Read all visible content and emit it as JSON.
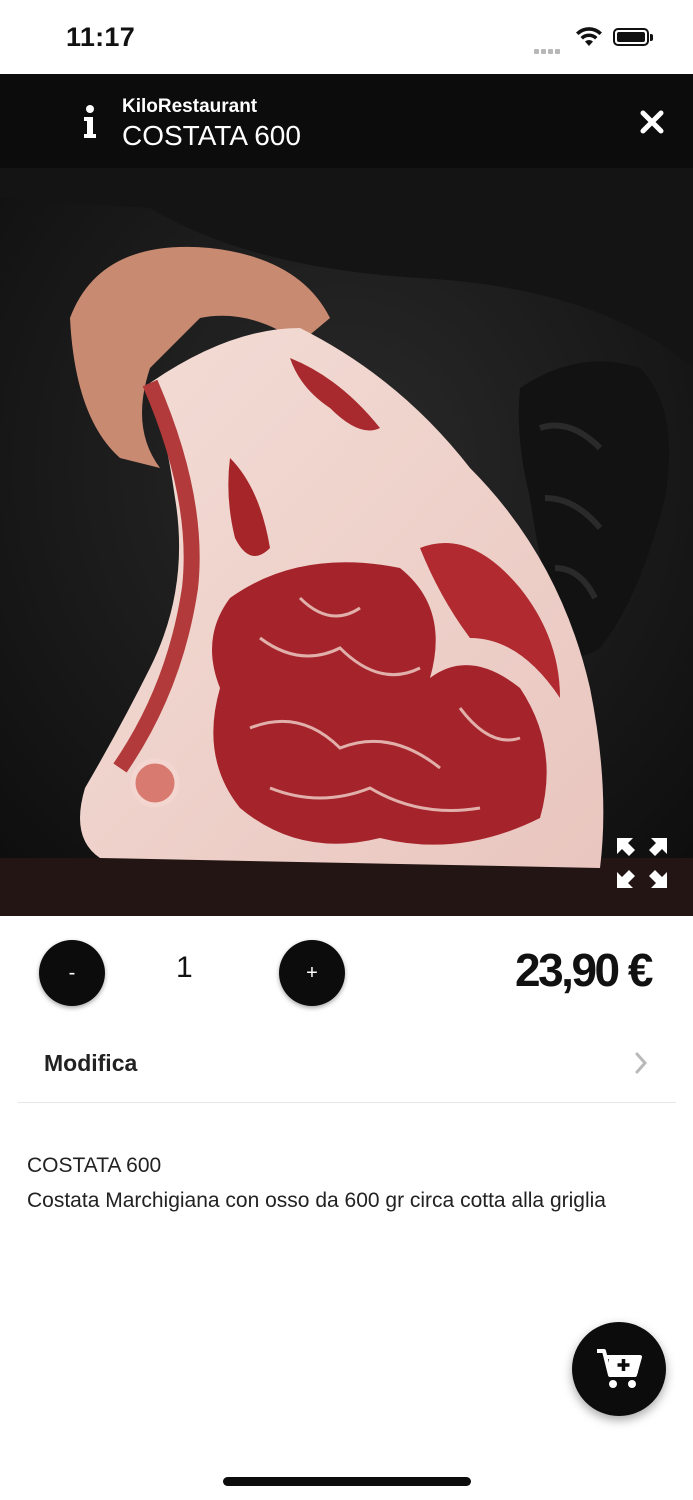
{
  "status_bar": {
    "time": "11:17"
  },
  "header": {
    "subtitle": "KiloRestaurant",
    "title": "COSTATA 600",
    "info_icon": "info-icon",
    "close_icon": "close-icon"
  },
  "hero": {
    "expand_icon": "expand-icon"
  },
  "quantity": {
    "minus_label": "-",
    "value": "1",
    "plus_label": "+"
  },
  "price": "23,90 €",
  "modifica": {
    "label": "Modifica",
    "icon": "chevron-right-icon"
  },
  "description": {
    "title": "COSTATA 600",
    "text": "Costata Marchigiana con osso da 600 gr circa cotta alla griglia"
  },
  "cart_button": {
    "icon": "cart-plus-icon"
  },
  "colors": {
    "header_bg": "#0c0c0c",
    "accent": "#0c0c0c",
    "background": "#ffffff"
  }
}
